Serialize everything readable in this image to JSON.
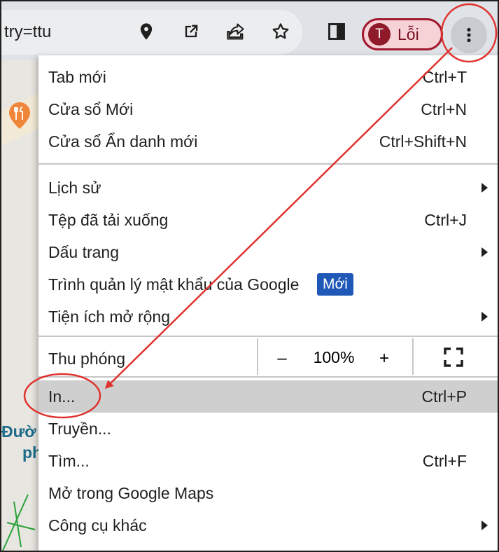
{
  "toolbar": {
    "url_text": "try=ttu",
    "icons": [
      "location-pin-icon",
      "open-external-icon",
      "share-icon",
      "star-icon",
      "side-panel-icon",
      "more-menu-icon"
    ],
    "profile": {
      "initial": "T",
      "label": "Lỗi"
    }
  },
  "map": {
    "text_line1": "Đườ",
    "text_line2": "ph"
  },
  "menu": {
    "items": [
      {
        "label": "Tab mới",
        "shortcut": "Ctrl+T"
      },
      {
        "label": "Cửa sổ Mới",
        "shortcut": "Ctrl+N"
      },
      {
        "label": "Cửa sổ Ẩn danh mới",
        "shortcut": "Ctrl+Shift+N"
      },
      {
        "label": "Lịch sử",
        "submenu": true
      },
      {
        "label": "Tệp đã tải xuống",
        "shortcut": "Ctrl+J"
      },
      {
        "label": "Dấu trang",
        "submenu": true
      },
      {
        "label": "Trình quản lý mật khẩu của Google",
        "badge": "Mới"
      },
      {
        "label": "Tiện ích mở rộng",
        "submenu": true
      },
      {
        "label": "In...",
        "shortcut": "Ctrl+P",
        "highlighted": true
      },
      {
        "label": "Truyền..."
      },
      {
        "label": "Tìm...",
        "shortcut": "Ctrl+F"
      },
      {
        "label": "Mở trong Google Maps"
      },
      {
        "label": "Công cụ khác",
        "submenu": true
      }
    ],
    "zoom": {
      "label": "Thu phóng",
      "minus": "–",
      "value": "100%",
      "plus": "+"
    }
  },
  "colors": {
    "annotation": "#e0322e",
    "badge": "#1f58b7",
    "highlight": "#cfcfcf"
  }
}
